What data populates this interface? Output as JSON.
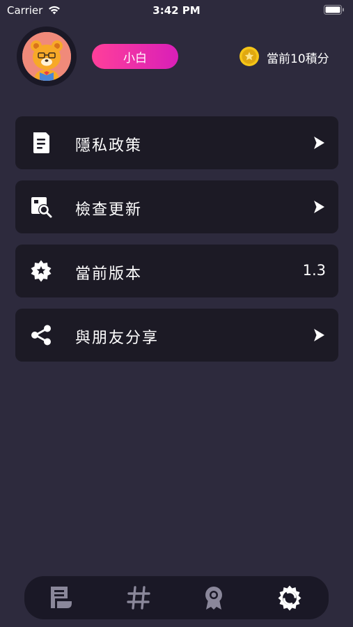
{
  "status_bar": {
    "carrier": "Carrier",
    "time": "3:42 PM",
    "icons": [
      "wifi-icon",
      "battery-icon"
    ]
  },
  "profile": {
    "name": "小白",
    "points_text": "當前10積分",
    "badge_gradient": [
      "#ff3f9a",
      "#d91fb8"
    ],
    "coin_color": "#f5c518"
  },
  "menu": {
    "items": [
      {
        "label": "隱私政策",
        "icon": "document-icon",
        "accessory": "arrow"
      },
      {
        "label": "檢查更新",
        "icon": "search-update-icon",
        "accessory": "arrow"
      },
      {
        "label": "當前版本",
        "icon": "settings-star-icon",
        "value": "1.3"
      },
      {
        "label": "與朋友分享",
        "icon": "share-icon",
        "accessory": "arrow"
      }
    ]
  },
  "tab_bar": {
    "tabs": [
      {
        "icon": "notes-icon",
        "active": false
      },
      {
        "icon": "hashtag-icon",
        "active": false
      },
      {
        "icon": "award-icon",
        "active": false
      },
      {
        "icon": "gear-icon",
        "active": true
      }
    ],
    "active_color": "#ffffff",
    "inactive_color": "#8a879a"
  },
  "colors": {
    "background": "#2d2a3d",
    "card": "#1c1a25",
    "tab_bar": "#1a1826"
  }
}
